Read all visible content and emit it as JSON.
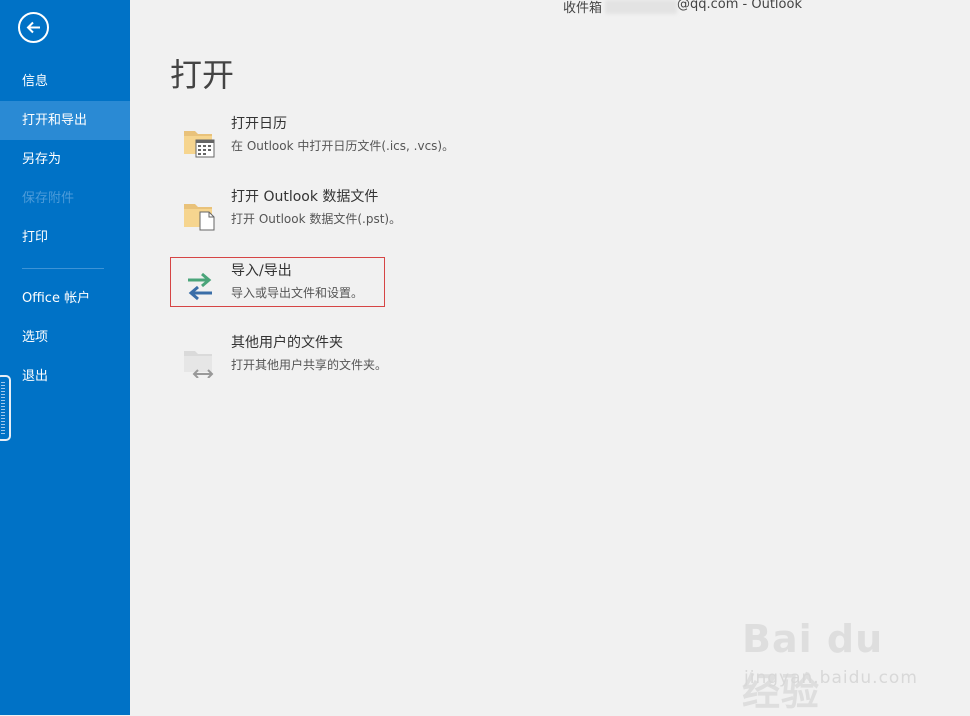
{
  "window": {
    "title_prefix": "收件箱",
    "account_suffix": "@qq.com - Outlook"
  },
  "sidebar": {
    "items": [
      {
        "label": "信息"
      },
      {
        "label": "打开和导出",
        "active": true
      },
      {
        "label": "另存为"
      },
      {
        "label": "保存附件",
        "disabled": true
      },
      {
        "label": "打印"
      },
      {
        "label": "Office 帐户"
      },
      {
        "label": "选项"
      },
      {
        "label": "退出"
      }
    ]
  },
  "main": {
    "title": "打开",
    "options": [
      {
        "title": "打开日历",
        "description": "在 Outlook 中打开日历文件(.ics, .vcs)。",
        "icon": "calendar-folder-icon"
      },
      {
        "title": "打开 Outlook 数据文件",
        "description": "打开 Outlook 数据文件(.pst)。",
        "icon": "data-file-folder-icon"
      },
      {
        "title": "导入/导出",
        "description": "导入或导出文件和设置。",
        "icon": "import-export-arrows-icon",
        "highlighted": true
      },
      {
        "title": "其他用户的文件夹",
        "description": "打开其他用户共享的文件夹。",
        "icon": "shared-folder-icon"
      }
    ]
  },
  "watermark": {
    "brand": "Bai du 经验",
    "url": "jingyan.baidu.com"
  },
  "colors": {
    "sidebar": "#0072c6",
    "sidebar_active": "#2a8ad4",
    "highlight_border": "#d64545",
    "background": "#f1f1f1"
  }
}
